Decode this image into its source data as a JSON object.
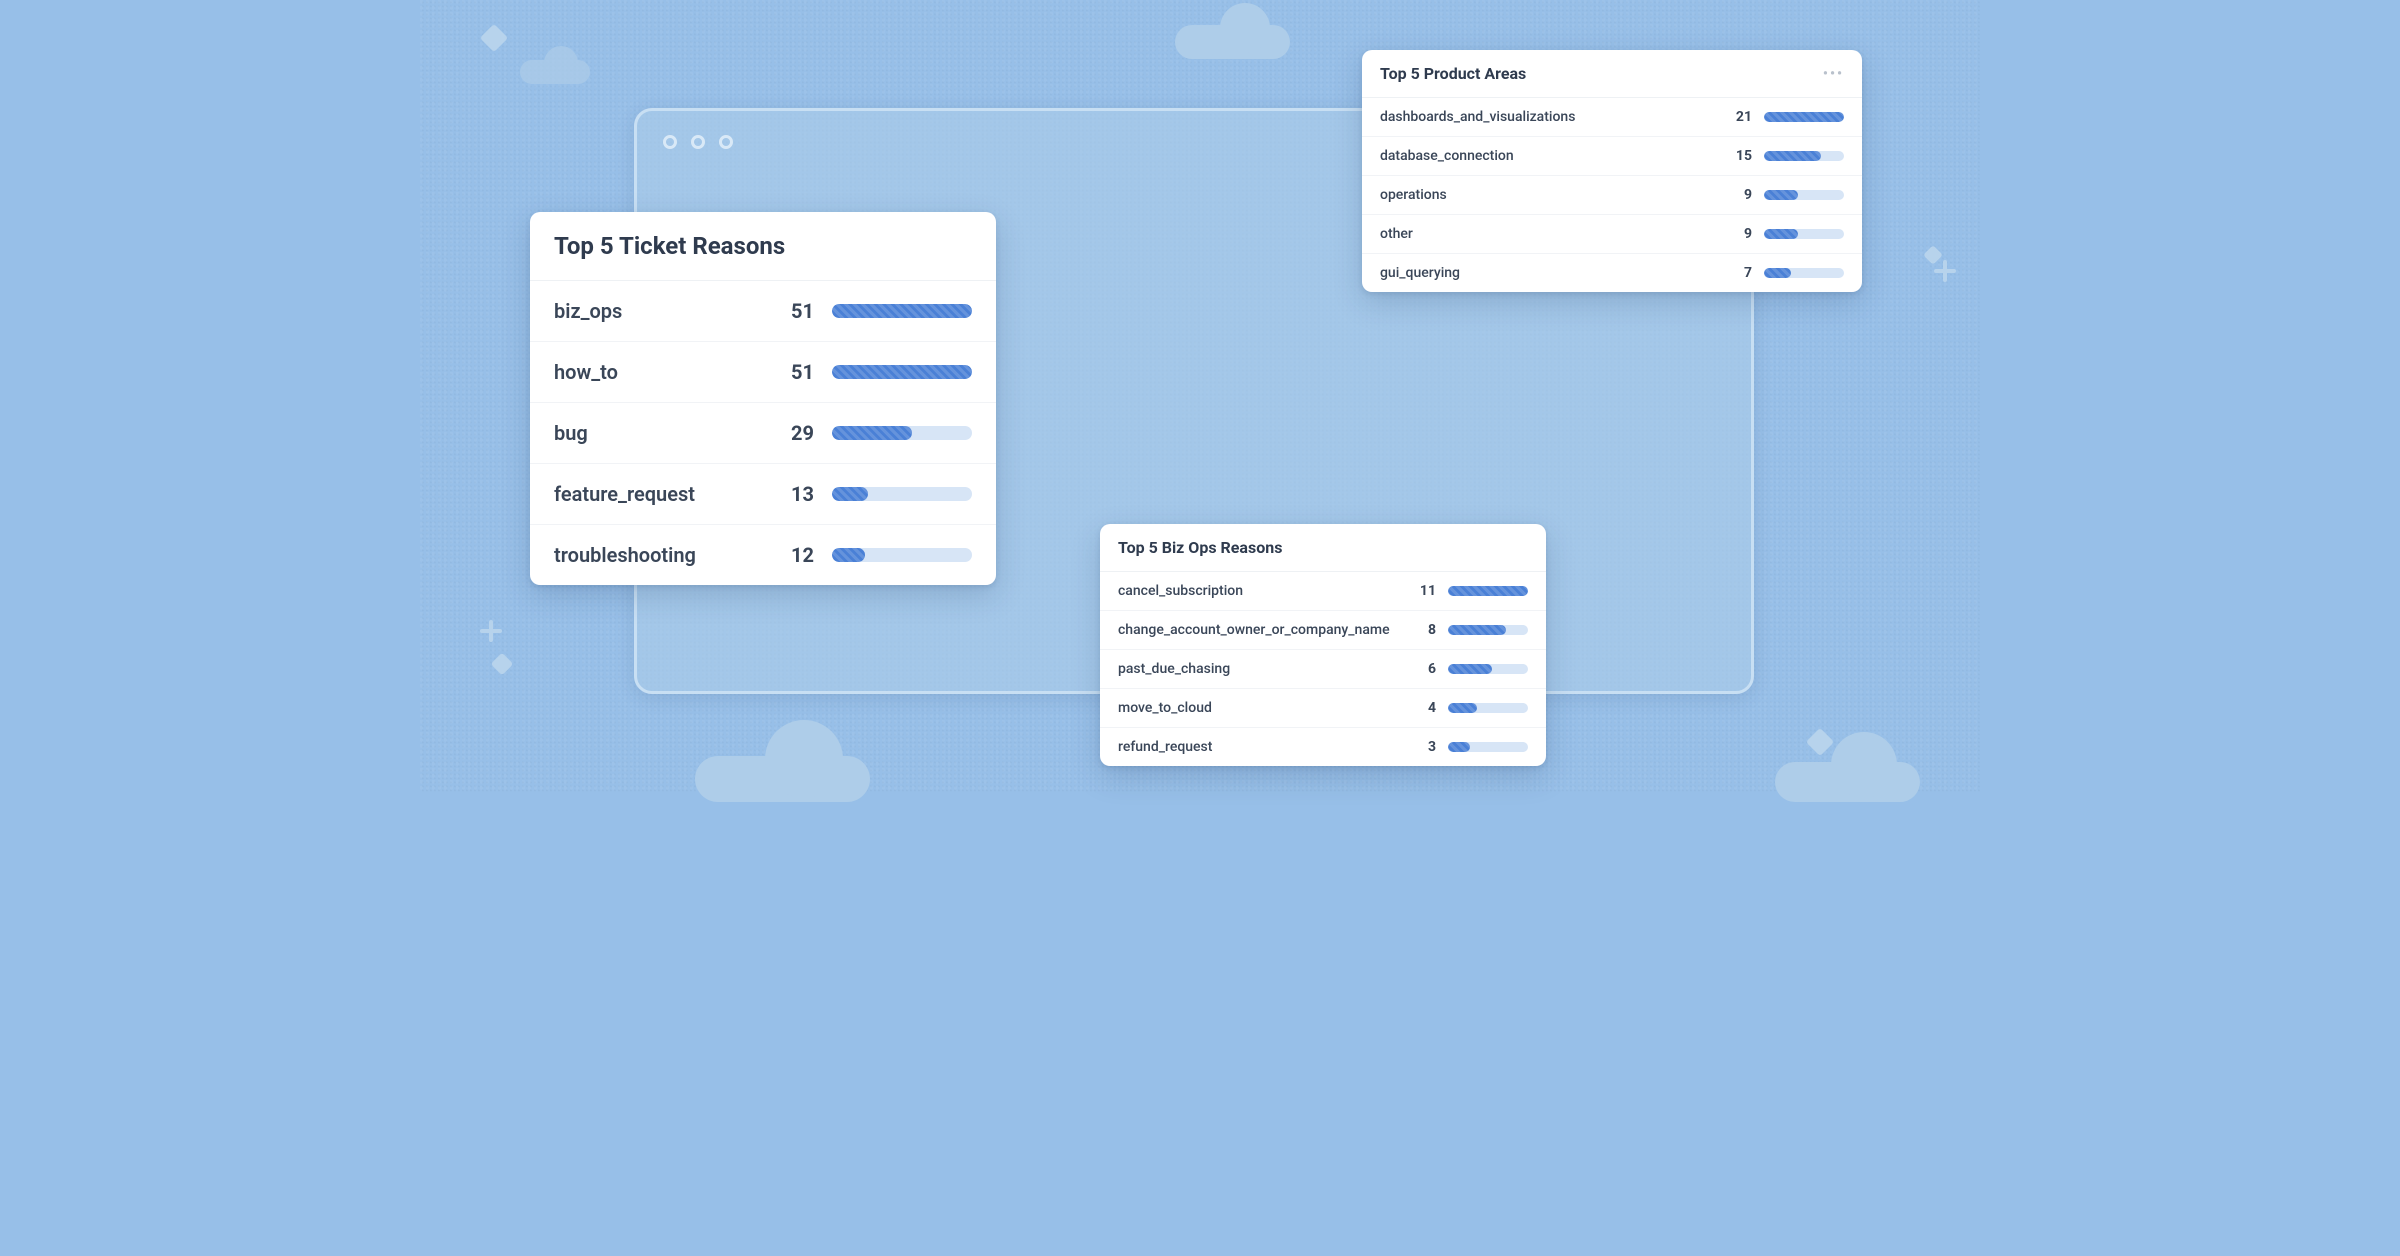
{
  "cards": {
    "ticket_reasons": {
      "title": "Top 5 Ticket Reasons",
      "max": 51,
      "rows": [
        {
          "label": "biz_ops",
          "value": 51
        },
        {
          "label": "how_to",
          "value": 51
        },
        {
          "label": "bug",
          "value": 29
        },
        {
          "label": "feature_request",
          "value": 13
        },
        {
          "label": "troubleshooting",
          "value": 12
        }
      ]
    },
    "biz_ops_reasons": {
      "title": "Top 5 Biz Ops Reasons",
      "max": 11,
      "rows": [
        {
          "label": "cancel_subscription",
          "value": 11
        },
        {
          "label": "change_account_owner_or_company_name",
          "value": 8
        },
        {
          "label": "past_due_chasing",
          "value": 6
        },
        {
          "label": "move_to_cloud",
          "value": 4
        },
        {
          "label": "refund_request",
          "value": 3
        }
      ]
    },
    "product_areas": {
      "title": "Top 5 Product Areas",
      "menu_glyph": "•••",
      "max": 21,
      "rows": [
        {
          "label": "dashboards_and_visualizations",
          "value": 21
        },
        {
          "label": "database_connection",
          "value": 15
        },
        {
          "label": "operations",
          "value": 9
        },
        {
          "label": "other",
          "value": 9
        },
        {
          "label": "gui_querying",
          "value": 7
        }
      ]
    }
  },
  "chart_data": [
    {
      "type": "bar",
      "title": "Top 5 Ticket Reasons",
      "categories": [
        "biz_ops",
        "how_to",
        "bug",
        "feature_request",
        "troubleshooting"
      ],
      "values": [
        51,
        51,
        29,
        13,
        12
      ],
      "xlabel": "",
      "ylabel": "",
      "ylim": [
        0,
        51
      ]
    },
    {
      "type": "bar",
      "title": "Top 5 Biz Ops Reasons",
      "categories": [
        "cancel_subscription",
        "change_account_owner_or_company_name",
        "past_due_chasing",
        "move_to_cloud",
        "refund_request"
      ],
      "values": [
        11,
        8,
        6,
        4,
        3
      ],
      "xlabel": "",
      "ylabel": "",
      "ylim": [
        0,
        11
      ]
    },
    {
      "type": "bar",
      "title": "Top 5 Product Areas",
      "categories": [
        "dashboards_and_visualizations",
        "database_connection",
        "operations",
        "other",
        "gui_querying"
      ],
      "values": [
        21,
        15,
        9,
        9,
        7
      ],
      "xlabel": "",
      "ylabel": "",
      "ylim": [
        0,
        21
      ]
    }
  ]
}
